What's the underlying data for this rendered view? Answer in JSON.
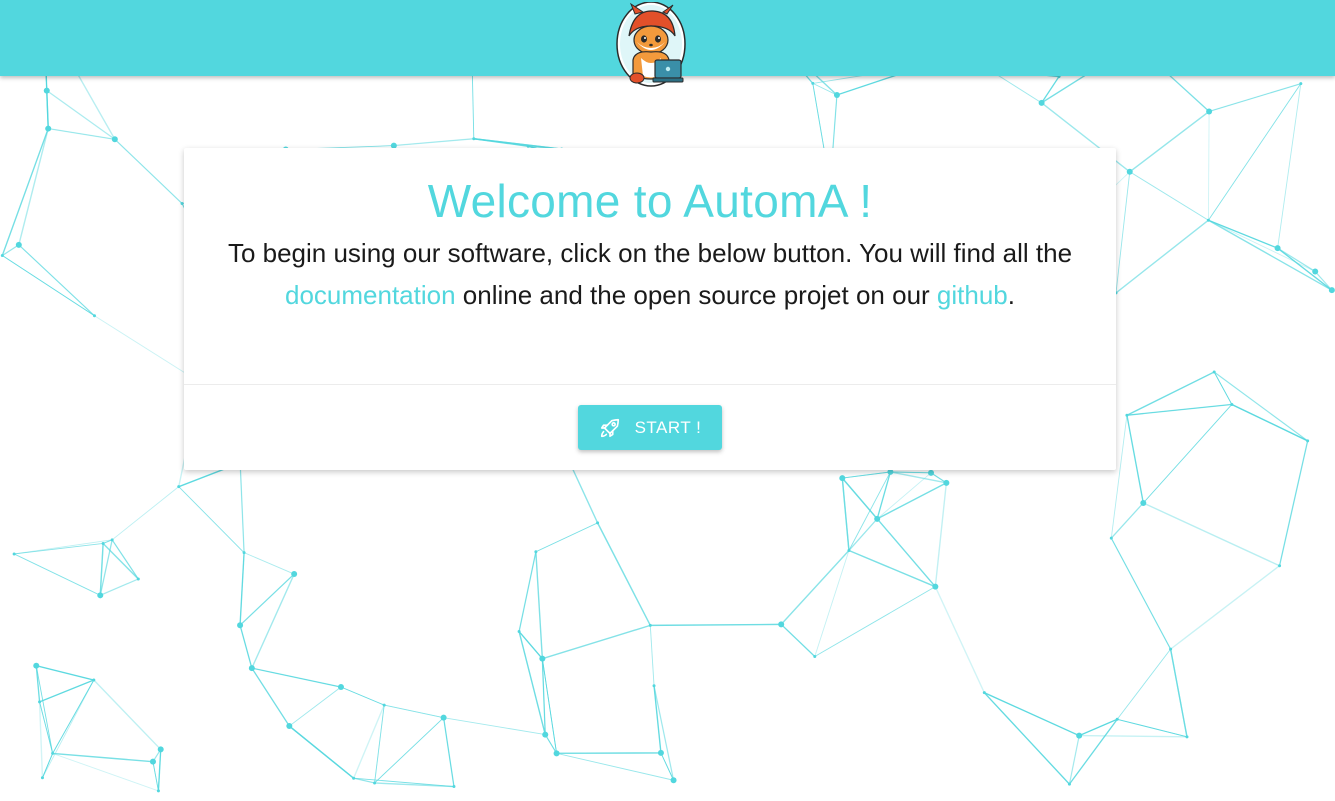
{
  "colors": {
    "accent": "#52d7de",
    "text": "#1a1a1a",
    "background": "#ffffff"
  },
  "header": {
    "logo_icon": "fox-mascot-laptop-logo"
  },
  "card": {
    "title": "Welcome to AutomA !",
    "text_before_doc": "To begin using our software, click on the below button. You will find all the ",
    "doc_link": "documentation",
    "text_middle": " online and the open source projet on our ",
    "github_link": "github",
    "text_end": ".",
    "start_button": {
      "label": "START !",
      "icon": "rocket-icon"
    }
  }
}
